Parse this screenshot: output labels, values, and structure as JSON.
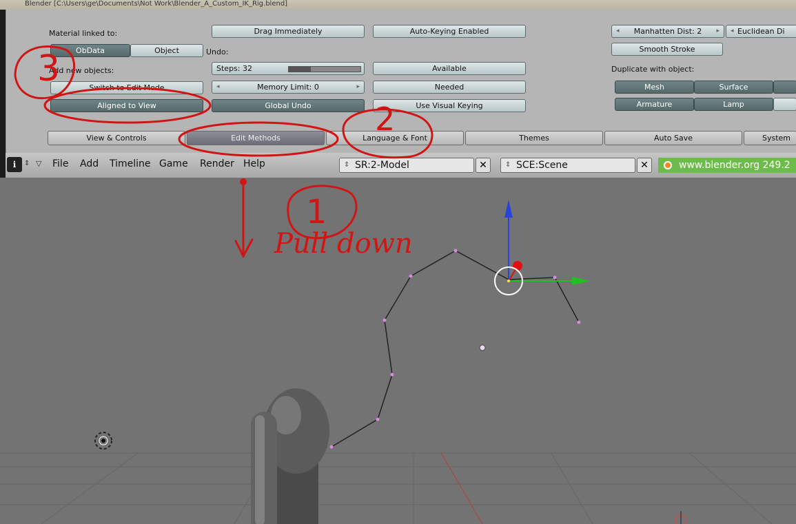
{
  "window": {
    "title": "Blender [C:\\Users\\ge\\Documents\\Not Work\\Blender_A_Custom_IK_Rig.blend]"
  },
  "prefs": {
    "material_linked_label": "Material linked to:",
    "obdata_btn": "ObData",
    "object_btn": "Object",
    "add_new_objects_label": "Add new objects:",
    "switch_edit_mode_btn": "Switch to Edit Mode",
    "aligned_to_view_btn": "Aligned to View",
    "drag_immediately_btn": "Drag Immediately",
    "undo_label": "Undo:",
    "steps_field": "Steps: 32",
    "memory_limit_field": "Memory Limit: 0",
    "global_undo_btn": "Global Undo",
    "auto_keying_btn": "Auto-Keying Enabled",
    "available_btn": "Available",
    "needed_btn": "Needed",
    "visual_keying_btn": "Use Visual Keying",
    "manhattan_field": "Manhatten Dist: 2",
    "euclidean_field": "Euclidean Di",
    "smooth_stroke_btn": "Smooth Stroke",
    "duplicate_label": "Duplicate with object:",
    "mesh_btn": "Mesh",
    "surface_btn": "Surface",
    "armature_btn": "Armature",
    "lamp_btn": "Lamp"
  },
  "tabs": [
    "View & Controls",
    "Edit Methods",
    "Language & Font",
    "Themes",
    "Auto Save",
    "System"
  ],
  "menubar": {
    "info_icon": "i",
    "items": [
      "File",
      "Add",
      "Timeline",
      "Game",
      "Render",
      "Help"
    ],
    "screen_field": "SR:2-Model",
    "scene_field": "SCE:Scene",
    "status": "www.blender.org 249.2"
  },
  "annotations": {
    "note1_number": "1",
    "note1_text": "Pull down",
    "note2_number": "2",
    "note3_number": "3"
  },
  "colors": {
    "panel_bg": "#b5b5b5",
    "button_light": "#c8d4d5",
    "button_dark": "#5f7375",
    "viewport_bg": "#737373",
    "annotation_red": "#d01515",
    "status_green": "#6dbb4b"
  }
}
